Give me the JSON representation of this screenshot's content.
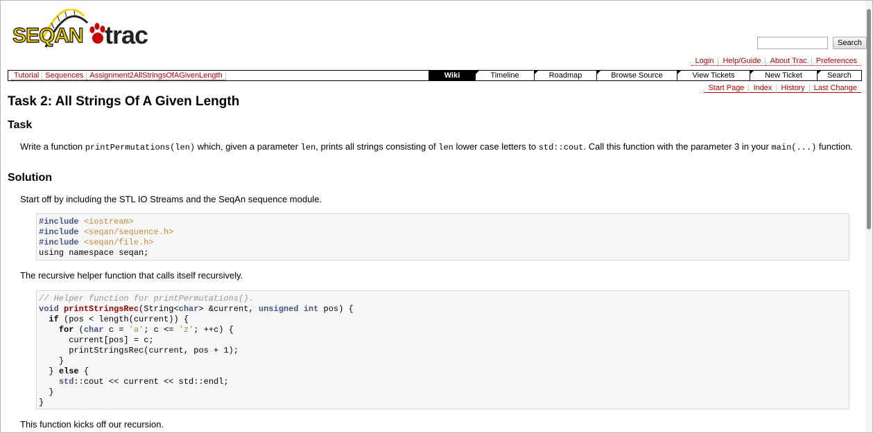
{
  "logo": {
    "seqan": "SEQAN",
    "trac": "trac"
  },
  "search": {
    "placeholder": "",
    "button_label": "Search"
  },
  "metanav": [
    "Login",
    "Help/Guide",
    "About Trac",
    "Preferences"
  ],
  "breadcrumbs": [
    "Tutorial",
    "Sequences",
    "Assignment2AllStringsOfAGivenLength"
  ],
  "tabs": [
    "Wiki",
    "Timeline",
    "Roadmap",
    "Browse Source",
    "View Tickets",
    "New Ticket",
    "Search"
  ],
  "active_tab": "Wiki",
  "ctxnav": [
    "Start Page",
    "Index",
    "History",
    "Last Change"
  ],
  "page": {
    "title": "Task 2: All Strings Of A Given Length",
    "section_task": "Task",
    "task_text": {
      "p1": "Write a function ",
      "c1": "printPermutations(len)",
      "p2": " which, given a parameter ",
      "c2": "len",
      "p3": ", prints all strings consisting of ",
      "c3": "len",
      "p4": " lower case letters to ",
      "c4": "std::cout",
      "p5": ". Call this function with the parameter 3 in your ",
      "c5": "main(...)",
      "p6": " function."
    },
    "section_solution": "Solution",
    "para1": "Start off by including the STL IO Streams and the SeqAn sequence module.",
    "para2": "The recursive helper function that calls itself recursively.",
    "para3": "This function kicks off our recursion."
  },
  "code1": {
    "l1_pp": "#include",
    "l1_inc": "<iostream>",
    "l2_pp": "#include",
    "l2_inc": "<seqan/sequence.h>",
    "l3_pp": "#include",
    "l3_inc": "<seqan/file.h>",
    "l4": "using namespace seqan;"
  },
  "code2": {
    "comment": "// Helper function for printPermutations().",
    "l2_void": "void",
    "l2_fn": "printStringsRec",
    "l2_a": "(String<",
    "l2_char": "char",
    "l2_b": "> &current, ",
    "l2_unsigned": "unsigned",
    "l2_int": "int",
    "l2_c": " pos) {",
    "l3_if": "if",
    "l3_rest": " (pos < length(current)) {",
    "l4_for": "for",
    "l4_a": " (",
    "l4_char": "char",
    "l4_b": " c = ",
    "l4_sa": "'a'",
    "l4_c": "; c <= ",
    "l4_sz": "'z'",
    "l4_d": "; ++c) {",
    "l5": "current[pos] = c;",
    "l6": "printStringsRec(current, pos + 1);",
    "l7": "}",
    "l8_a": "} ",
    "l8_else": "else",
    "l8_b": " {",
    "l9_std": "std",
    "l9_rest": "::cout << current << std::endl;",
    "l10": "}",
    "l11": "}"
  },
  "colors": {
    "link": "#bb0000",
    "keyword": "#445588",
    "string": "#c4883a",
    "comment": "#999988",
    "function": "#990000"
  }
}
